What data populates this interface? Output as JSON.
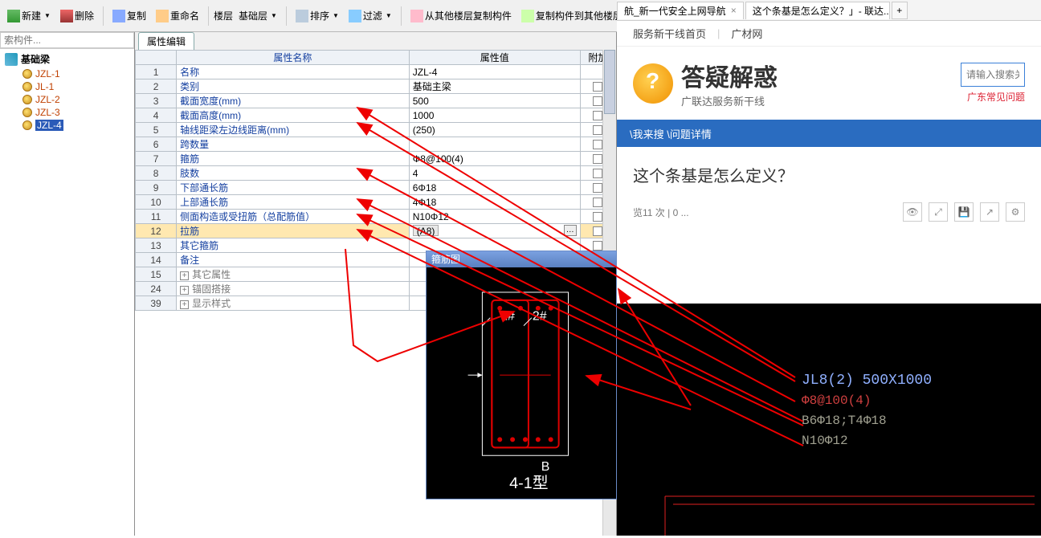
{
  "toolbar": {
    "new": "新建",
    "delete": "删除",
    "copy": "复制",
    "rename": "重命名",
    "floor": "楼层",
    "floor_sel": "基础层",
    "sort": "排序",
    "filter": "过滤",
    "copy_from": "从其他楼层复制构件",
    "copy_to": "复制构件到其他楼层",
    "search_placeholder": "索构件..."
  },
  "tree": {
    "root": "基础梁",
    "items": [
      "JZL-1",
      "JL-1",
      "JZL-2",
      "JZL-3",
      "JZL-4"
    ],
    "selected": 4
  },
  "props": {
    "tab": "属性编辑",
    "headers": {
      "name": "属性名称",
      "value": "属性值",
      "add": "附加"
    },
    "rows": [
      {
        "n": 1,
        "name": "名称",
        "name_color": "blue",
        "val": "JZL-4",
        "chk": false
      },
      {
        "n": 2,
        "name": "类别",
        "name_color": "blue",
        "val": "基础主梁",
        "chk": true
      },
      {
        "n": 3,
        "name": "截面宽度(mm)",
        "name_color": "blue",
        "val": "500",
        "chk": true
      },
      {
        "n": 4,
        "name": "截面高度(mm)",
        "name_color": "blue",
        "val": "1000",
        "chk": true
      },
      {
        "n": 5,
        "name": "轴线距梁左边线距离(mm)",
        "name_color": "blue",
        "val": "(250)",
        "chk": true
      },
      {
        "n": 6,
        "name": "跨数量",
        "name_color": "blue",
        "val": "",
        "chk": true
      },
      {
        "n": 7,
        "name": "箍筋",
        "name_color": "blue",
        "val": "Φ8@100(4)",
        "chk": true
      },
      {
        "n": 8,
        "name": "肢数",
        "name_color": "blue",
        "val": "4",
        "chk": true
      },
      {
        "n": 9,
        "name": "下部通长筋",
        "name_color": "blue",
        "val": "6Φ18",
        "chk": true
      },
      {
        "n": 10,
        "name": "上部通长筋",
        "name_color": "blue",
        "val": "4Φ18",
        "chk": true
      },
      {
        "n": 11,
        "name": "侧面构造或受扭筋（总配筋值）",
        "name_color": "blue",
        "val": "N10Φ12",
        "chk": true
      },
      {
        "n": 12,
        "name": "拉筋",
        "name_color": "blue",
        "val": "(A8)",
        "chk": true,
        "hl": true,
        "ellipsis": true
      },
      {
        "n": 13,
        "name": "其它箍筋",
        "name_color": "blue",
        "val": "",
        "chk": true
      },
      {
        "n": 14,
        "name": "备注",
        "name_color": "blue",
        "val": "",
        "chk": true
      },
      {
        "n": 15,
        "name": "其它属性",
        "name_color": "gray",
        "val": "",
        "expand": true
      },
      {
        "n": 24,
        "name": "锚固搭接",
        "name_color": "gray",
        "val": "",
        "expand": true
      },
      {
        "n": 39,
        "name": "显示样式",
        "name_color": "gray",
        "val": "",
        "expand": true
      }
    ]
  },
  "stirrup": {
    "title": "箍筋图",
    "label1": "1#",
    "label2": "2#",
    "bottom_b": "B",
    "bottom_type": "4-1型"
  },
  "browser": {
    "tabs": [
      {
        "label": "航_新一代安全上网导航"
      },
      {
        "label": "这个条基是怎么定义？」- 联达..."
      }
    ],
    "links": {
      "home": "服务新干线首页",
      "guide": "广材网"
    },
    "hero": {
      "title": "答疑解惑",
      "sub": "广联达服务新干线"
    },
    "search": {
      "placeholder": "请输入搜索关",
      "hot": "广东常见问题"
    },
    "breadcrumb": "\\我来搜 \\问题详情",
    "question": "这个条基是怎么定义？",
    "meta": "览11 次 | 0 ...",
    "cad": {
      "line1": "JL8(2) 500X1000",
      "line2": "Φ8@100(4)",
      "line3": "B6Φ18;T4Φ18",
      "line4": "N10Φ12"
    }
  }
}
